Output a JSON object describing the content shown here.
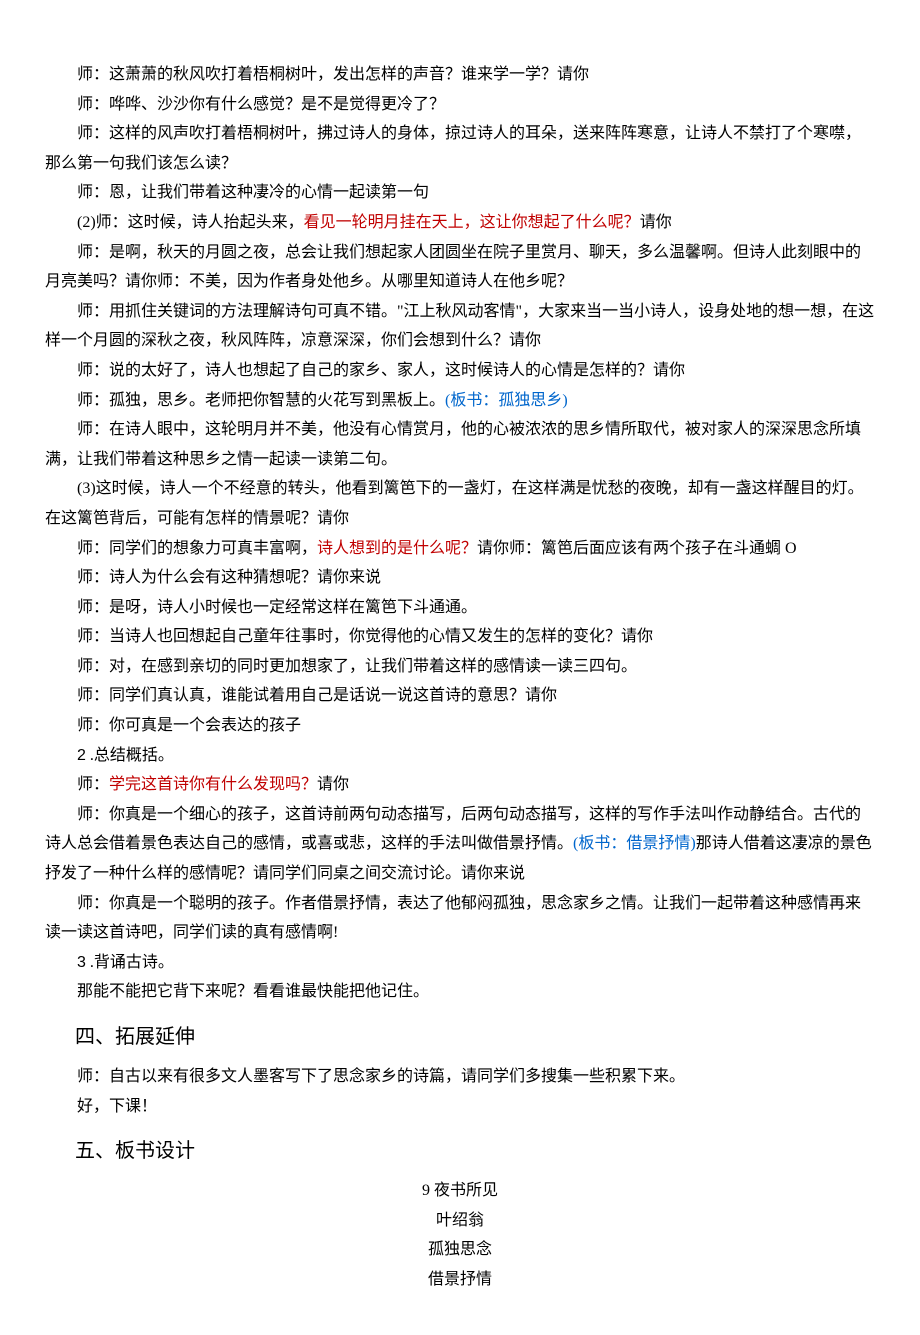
{
  "p1": "师：这萧萧的秋风吹打着梧桐树叶，发出怎样的声音？谁来学一学？请你",
  "p2": "师：哗哗、沙沙你有什么感觉？是不是觉得更冷了？",
  "p3": "师：这样的风声吹打着梧桐树叶，拂过诗人的身体，掠过诗人的耳朵，送来阵阵寒意，让诗人不禁打了个寒噤，那么第一句我们该怎么读？",
  "p4": "师：恩，让我们带着这种凄冷的心情一起读第一句",
  "p5_prefix": "(2)师：这时候，诗人抬起头来，",
  "p5_red": "看见一轮明月挂在天上，这让你想起了什么呢？",
  "p5_suffix": "请你",
  "p6": "师：是啊，秋天的月圆之夜，总会让我们想起家人团圆坐在院子里赏月、聊天，多么温馨啊。但诗人此刻眼中的月亮美吗？请你师：不美，因为作者身处他乡。从哪里知道诗人在他乡呢？",
  "p7": "师：用抓住关键词的方法理解诗句可真不错。\"江上秋风动客情\"，大家来当一当小诗人，设身处地的想一想，在这样一个月圆的深秋之夜，秋风阵阵，凉意深深，你们会想到什么？请你",
  "p8": "师：说的太好了，诗人也想起了自己的家乡、家人，这时候诗人的心情是怎样的？请你",
  "p9_prefix": "师：孤独，思乡。老师把你智慧的火花写到黑板上。",
  "p9_blue": "(板书：孤独思乡)",
  "p10": "师：在诗人眼中，这轮明月并不美，他没有心情赏月，他的心被浓浓的思乡情所取代，被对家人的深深思念所填满，让我们带着这种思乡之情一起读一读第二句。",
  "p11": "(3)这时候，诗人一个不经意的转头，他看到篱笆下的一盏灯，在这样满是忧愁的夜晚，却有一盏这样醒目的灯。在这篱笆背后，可能有怎样的情景呢？请你",
  "p12_prefix": "师：同学们的想象力可真丰富啊，",
  "p12_red": "诗人想到的是什么呢？",
  "p12_suffix": "请你师：篱笆后面应该有两个孩子在斗通蜩 O",
  "p13": "师：诗人为什么会有这种猜想呢？请你来说",
  "p14": "师：是呀，诗人小时候也一定经常这样在篱笆下斗通通。",
  "p15": "师：当诗人也回想起自己童年往事时，你觉得他的心情又发生的怎样的变化？请你",
  "p16": "师：对，在感到亲切的同时更加想家了，让我们带着这样的感情读一读三四句。",
  "p17": "师：同学们真认真，谁能试着用自己是话说一说这首诗的意思？请你",
  "p18": "师：你可真是一个会表达的孩子",
  "p19_num": "2",
  "p19_text": " .总结概括。",
  "p20_prefix": "师：",
  "p20_red": "学完这首诗你有什么发现吗？",
  "p20_suffix": "请你",
  "p21_prefix": "师：你真是一个细心的孩子，这首诗前两句动态描写，后两句动态描写，这样的写作手法叫作动静结合。古代的诗人总会借着景色表达自己的感情，或喜或悲，这样的手法叫做借景抒情。",
  "p21_blue": "(板书：借景抒情)",
  "p21_suffix": "那诗人借着这凄凉的景色抒发了一种什么样的感情呢？请同学们同桌之间交流讨论。请你来说",
  "p22": "师：你真是一个聪明的孩子。作者借景抒情，表达了他郁闷孤独，思念家乡之情。让我们一起带着这种感情再来读一读这首诗吧，同学们读的真有感情啊!",
  "p23_num": "3",
  "p23_text": " .背诵古诗。",
  "p24": "那能不能把它背下来呢？看看谁最快能把他记住。",
  "h4": "四、拓展延伸",
  "p25": "师：自古以来有很多文人墨客写下了思念家乡的诗篇，请同学们多搜集一些积累下来。",
  "p26": "好，下课！",
  "h5": "五、板书设计",
  "board1": "9 夜书所见",
  "board2": "叶绍翁",
  "board3": "孤独思念",
  "board4": "借景抒情"
}
